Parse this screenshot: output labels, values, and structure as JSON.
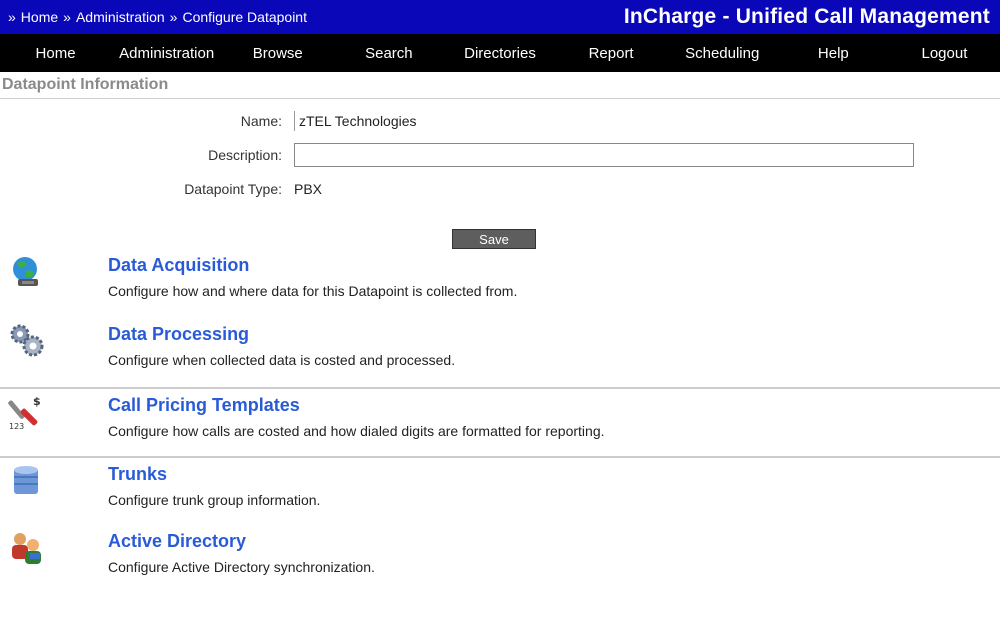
{
  "breadcrumb": {
    "items": [
      "Home",
      "Administration",
      "Configure Datapoint"
    ],
    "separator": "»"
  },
  "app_title": "InCharge - Unified Call Management",
  "nav": {
    "items": [
      "Home",
      "Administration",
      "Browse",
      "Search",
      "Directories",
      "Report",
      "Scheduling",
      "Help",
      "Logout"
    ]
  },
  "section": {
    "title": "Datapoint Information"
  },
  "form": {
    "name_label": "Name:",
    "name_value": "zTEL Technologies",
    "description_label": "Description:",
    "description_value": "",
    "type_label": "Datapoint Type:",
    "type_value": "PBX",
    "save_label": "Save"
  },
  "config_items": [
    {
      "title": "Data Acquisition",
      "description": "Configure how and where data for this Datapoint is collected from.",
      "icon": "globe-icon"
    },
    {
      "title": "Data Processing",
      "description": "Configure when collected data is costed and processed.",
      "icon": "gears-icon"
    },
    {
      "title": "Call Pricing Templates",
      "description": "Configure how calls are costed and how dialed digits are formatted for reporting.",
      "icon": "pricing-tools-icon"
    },
    {
      "title": "Trunks",
      "description": "Configure trunk group information.",
      "icon": "database-icon"
    },
    {
      "title": "Active Directory",
      "description": "Configure Active Directory synchronization.",
      "icon": "users-icon"
    }
  ],
  "colors": {
    "topbar": "#0a07b8",
    "navbar": "#000000",
    "link": "#2a5bd7"
  }
}
